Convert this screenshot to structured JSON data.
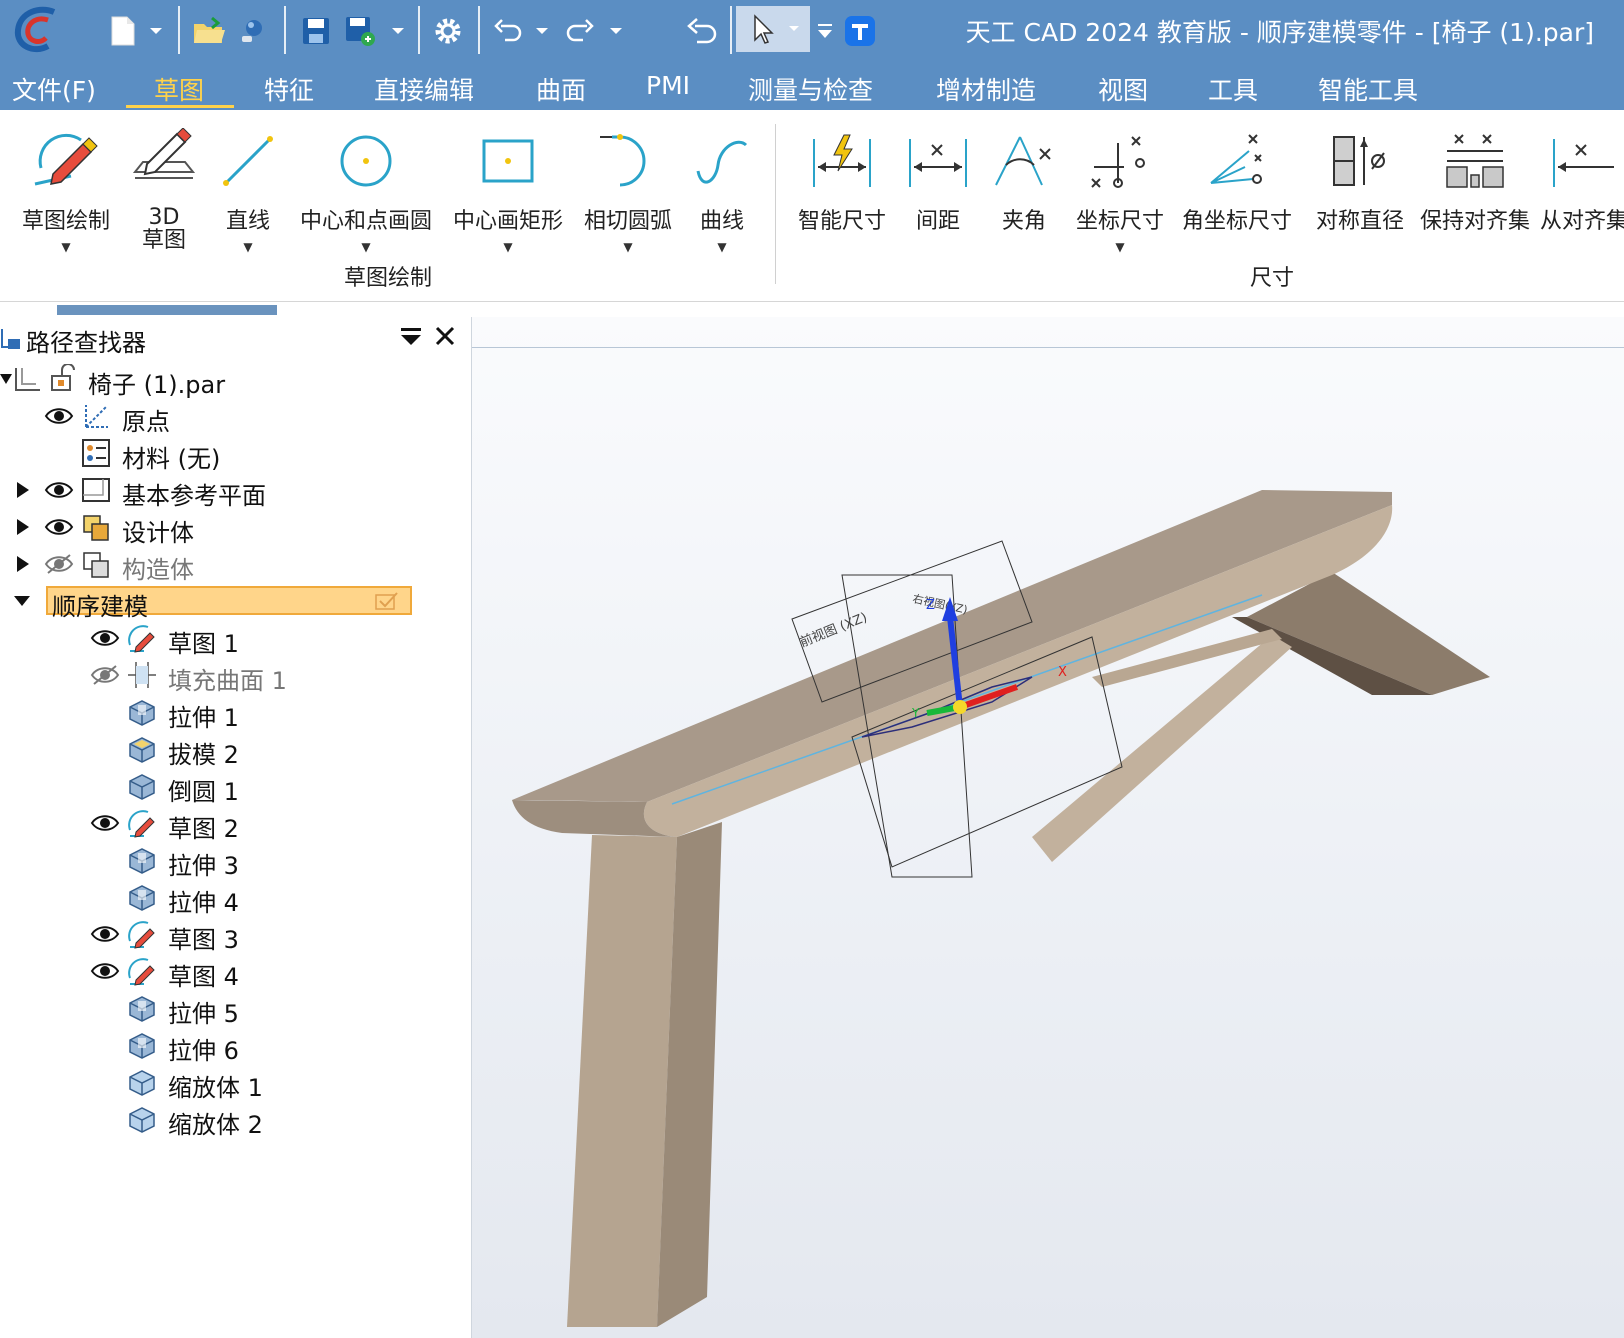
{
  "app": {
    "title": "天工 CAD 2024 教育版 - 顺序建模零件 - [椅子 (1).par]"
  },
  "quick_access": {
    "icons": [
      "app-logo-icon",
      "new-file-icon",
      "dropdown-icon",
      "open-folder-icon",
      "find-icon",
      "save-icon",
      "save-as-icon",
      "dropdown-icon",
      "settings-gear-icon",
      "undo-icon",
      "redo-icon",
      "revert-icon",
      "select-pointer-icon",
      "command-finder-icon"
    ]
  },
  "menu": {
    "file": "文件(F)",
    "sketch": "草图",
    "feature": "特征",
    "direct_edit": "直接编辑",
    "surface": "曲面",
    "pmi": "PMI",
    "measure": "测量与检查",
    "additive": "增材制造",
    "view": "视图",
    "tools": "工具",
    "smart_tools": "智能工具"
  },
  "ribbon": {
    "sketch_group": {
      "label": "草图绘制",
      "buttons": [
        {
          "label": "草图绘制"
        },
        {
          "label": "3D\n草图"
        },
        {
          "label": "直线"
        },
        {
          "label": "中心和点画圆"
        },
        {
          "label": "中心画矩形"
        },
        {
          "label": "相切圆弧"
        },
        {
          "label": "曲线"
        }
      ]
    },
    "dimension_group": {
      "label": "尺寸",
      "buttons": [
        {
          "label": "智能尺寸"
        },
        {
          "label": "间距"
        },
        {
          "label": "夹角"
        },
        {
          "label": "坐标尺寸"
        },
        {
          "label": "角坐标尺寸"
        },
        {
          "label": "对称直径"
        },
        {
          "label": "保持对齐集"
        },
        {
          "label": "从对齐集"
        }
      ]
    }
  },
  "pathfinder": {
    "title": "路径查找器",
    "root": "椅子 (1).par",
    "items": [
      {
        "label": "原点"
      },
      {
        "label": "材料 (无)"
      },
      {
        "label": "基本参考平面"
      },
      {
        "label": "设计体"
      },
      {
        "label": "构造体"
      },
      {
        "label": "顺序建模"
      },
      {
        "label": "草图 1"
      },
      {
        "label": "填充曲面 1"
      },
      {
        "label": "拉伸 1"
      },
      {
        "label": "拔模 2"
      },
      {
        "label": "倒圆 1"
      },
      {
        "label": "草图 2"
      },
      {
        "label": "拉伸 3"
      },
      {
        "label": "拉伸 4"
      },
      {
        "label": "草图 3"
      },
      {
        "label": "草图 4"
      },
      {
        "label": "拉伸 5"
      },
      {
        "label": "拉伸 6"
      },
      {
        "label": "缩放体 1"
      },
      {
        "label": "缩放体 2"
      }
    ]
  },
  "viewport": {
    "plane_label_front": "前视图 (XZ)",
    "plane_label_right": "右视图(YZ)",
    "axis_z": "Z",
    "axis_x": "X",
    "axis_y": "Y"
  },
  "colors": {
    "title_bar": "#5b8ec3",
    "active_tab": "#ffd24a",
    "selection_fill": "#ffd58a",
    "model_top": "#a8998a",
    "model_side": "#c2b19d",
    "model_dark": "#6e5f50"
  }
}
